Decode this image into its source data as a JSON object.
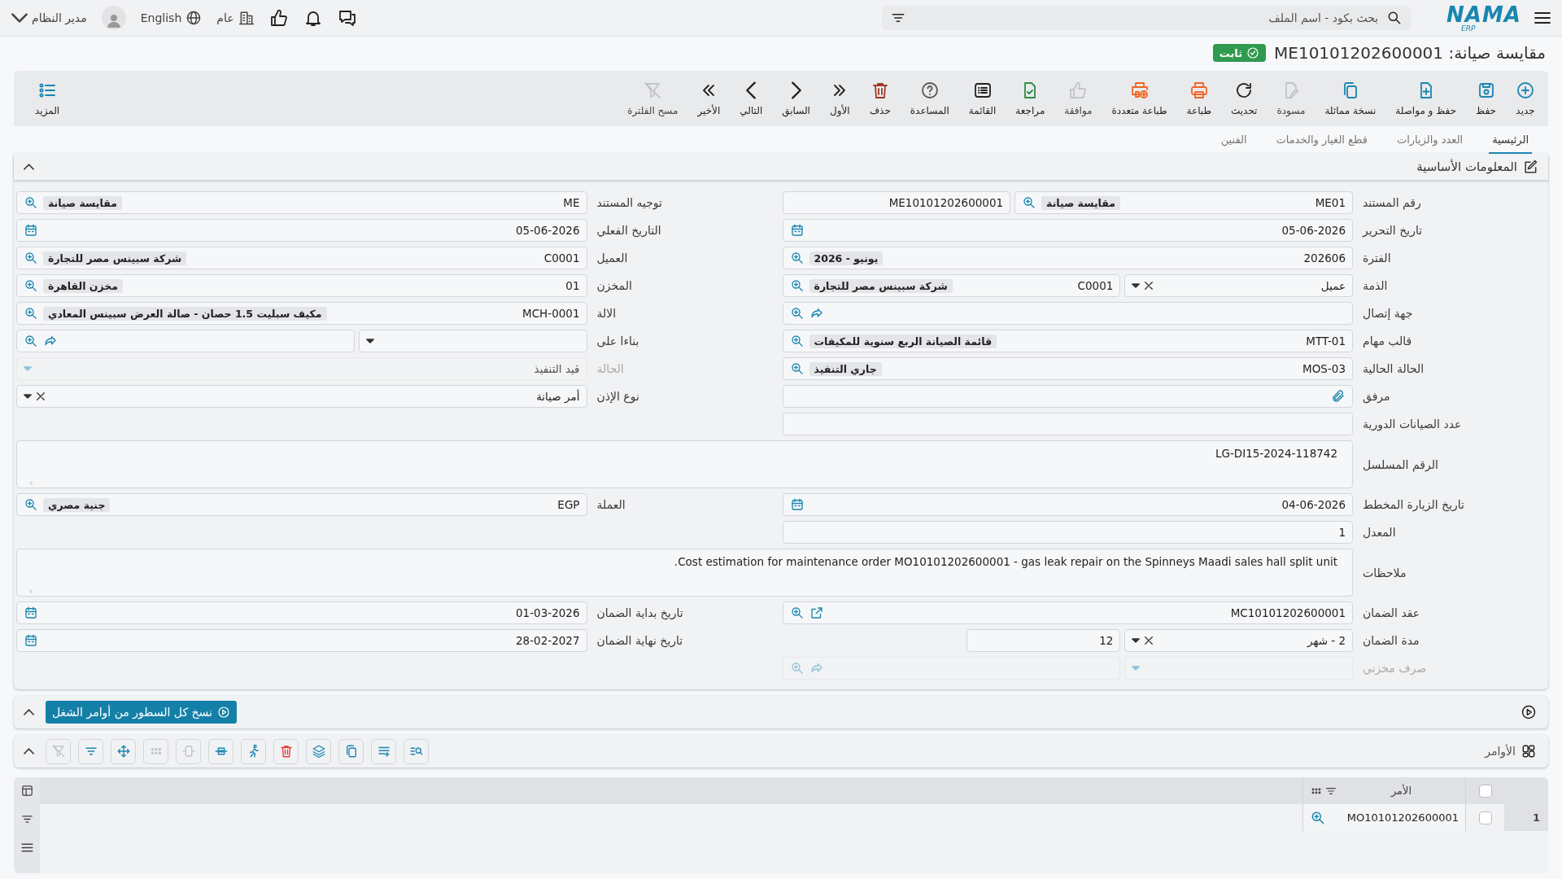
{
  "header": {
    "logo": "NAMA",
    "logo_sub": "ERP",
    "search": {
      "placeholder": "بحث بكود - اسم الملف"
    },
    "branch": "عام",
    "language": "English",
    "user": "مدير النظام"
  },
  "title": {
    "text": "مقايسة صيانة: ME10101202600001",
    "status": "ثابت"
  },
  "toolbar": [
    {
      "kind": "new",
      "label": "جديد",
      "disabled": false
    },
    {
      "kind": "save",
      "label": "حفظ",
      "disabled": false
    },
    {
      "kind": "save-continue",
      "label": "حفظ و مواصلة",
      "disabled": false
    },
    {
      "kind": "duplicate",
      "label": "نسخة مماثلة",
      "disabled": false
    },
    {
      "kind": "draft",
      "label": "مسودة",
      "disabled": true
    },
    {
      "kind": "refresh",
      "label": "تحديث",
      "disabled": false
    },
    {
      "kind": "print",
      "label": "طباعة",
      "disabled": false
    },
    {
      "kind": "print-multi",
      "label": "طباعة متعددة",
      "disabled": false
    },
    {
      "kind": "approve",
      "label": "موافقة",
      "disabled": true
    },
    {
      "kind": "review",
      "label": "مراجعة",
      "disabled": false
    },
    {
      "kind": "list",
      "label": "القائمة",
      "disabled": false
    },
    {
      "kind": "help",
      "label": "المساعدة",
      "disabled": false
    },
    {
      "kind": "delete",
      "label": "حذف",
      "disabled": false
    },
    {
      "kind": "first",
      "label": "الأول",
      "disabled": false
    },
    {
      "kind": "previous",
      "label": "السابق",
      "disabled": false
    },
    {
      "kind": "next",
      "label": "التالي",
      "disabled": false
    },
    {
      "kind": "last",
      "label": "الأخير",
      "disabled": false
    },
    {
      "kind": "clear-filter",
      "label": "مسح الفلترة",
      "disabled": true
    }
  ],
  "more": "المزيد",
  "tabs": [
    {
      "label": "الرئيسية",
      "selected": true
    },
    {
      "label": "العدد والزيارات",
      "selected": false
    },
    {
      "label": "قطع الغيار والخدمات",
      "selected": false
    },
    {
      "label": "الفنين",
      "selected": false
    }
  ],
  "section": {
    "title": "المعلومات الأساسية",
    "expanded": true,
    "rows": [
      {
        "kind": "pair",
        "cells": [
          {
            "label": "رقم المستند",
            "disabled": false,
            "parts": [
              {
                "kind": "lookup",
                "value": "ME01",
                "chip": "مقايسة صيانة"
              },
              {
                "kind": "text",
                "value": "ME10101202600001"
              }
            ]
          },
          {
            "label": "توجيه المستند",
            "disabled": false,
            "parts": [
              {
                "kind": "lookup",
                "value": "ME",
                "chip": "مقايسة صيانة"
              }
            ]
          }
        ]
      },
      {
        "kind": "pair",
        "cells": [
          {
            "label": "تاريخ التحرير",
            "disabled": false,
            "parts": [
              {
                "kind": "date",
                "value": "05-06-2026"
              }
            ]
          },
          {
            "label": "التاريخ الفعلي",
            "disabled": false,
            "parts": [
              {
                "kind": "date",
                "value": "05-06-2026"
              }
            ]
          }
        ]
      },
      {
        "kind": "pair",
        "cells": [
          {
            "label": "الفترة",
            "disabled": false,
            "parts": [
              {
                "kind": "lookup",
                "value": "202606",
                "chip": "يونيو - 2026"
              }
            ]
          },
          {
            "label": "العميل",
            "disabled": false,
            "parts": [
              {
                "kind": "lookup",
                "value": "C0001",
                "chip": "شركة سبينس مصر للتجارة"
              }
            ]
          }
        ]
      },
      {
        "kind": "pair",
        "cells": [
          {
            "label": "الذمة",
            "disabled": false,
            "parts": [
              {
                "kind": "select",
                "value": "عميل",
                "clearable": true
              },
              {
                "kind": "lookup",
                "value": "C0001",
                "chip": "شركة سبينس مصر للتجارة"
              }
            ]
          },
          {
            "label": "المخزن",
            "disabled": false,
            "parts": [
              {
                "kind": "lookup",
                "value": "01",
                "chip": "مخزن القاهرة"
              }
            ]
          }
        ]
      },
      {
        "kind": "pair",
        "cells": [
          {
            "label": "جهة إتصال",
            "disabled": false,
            "parts": [
              {
                "kind": "lookup-share"
              }
            ]
          },
          {
            "label": "الالة",
            "disabled": false,
            "parts": [
              {
                "kind": "lookup",
                "value": "MCH-0001",
                "chip": "مكيف سبليت 1.5 حصان - صالة العرض سبينس المعادي"
              }
            ]
          }
        ]
      },
      {
        "kind": "pair",
        "cells": [
          {
            "label": "قالب مهام",
            "disabled": false,
            "parts": [
              {
                "kind": "lookup",
                "value": "MTT-01",
                "chip": "قائمة الصيانة الربع سنوية للمكيفات"
              }
            ]
          },
          {
            "label": "بناءا على",
            "disabled": false,
            "parts": [
              {
                "kind": "select",
                "clearable": false
              },
              {
                "kind": "lookup-share"
              }
            ]
          }
        ]
      },
      {
        "kind": "pair",
        "cells": [
          {
            "label": "الحالة الحالية",
            "disabled": false,
            "parts": [
              {
                "kind": "lookup",
                "value": "MOS-03",
                "chip": "جاري التنفيذ"
              }
            ]
          },
          {
            "label": "الحالة",
            "disabled": true,
            "parts": [
              {
                "kind": "select",
                "value": "قيد التنفيذ",
                "clearable": false
              }
            ]
          }
        ]
      },
      {
        "kind": "pair",
        "cells": [
          {
            "label": "مرفق",
            "disabled": false,
            "parts": [
              {
                "kind": "attach"
              }
            ]
          },
          {
            "label": "نوع الإذن",
            "disabled": false,
            "parts": [
              {
                "kind": "select",
                "value": "أمر صيانة",
                "clearable": true
              }
            ]
          }
        ]
      },
      {
        "kind": "pair",
        "cells": [
          {
            "label": "عدد الصيانات الدورية",
            "disabled": false,
            "parts": [
              {
                "kind": "text"
              }
            ]
          }
        ]
      },
      {
        "kind": "wide",
        "cells": [
          {
            "label": "الرقم المسلسل",
            "disabled": false,
            "parts": [
              {
                "kind": "textarea",
                "value": "LG-DI15-2024-118742"
              }
            ]
          }
        ]
      },
      {
        "kind": "pair",
        "cells": [
          {
            "label": "تاريخ الزيارة المخطط",
            "disabled": false,
            "parts": [
              {
                "kind": "date",
                "value": "04-06-2026"
              }
            ]
          },
          {
            "label": "العملة",
            "disabled": false,
            "parts": [
              {
                "kind": "lookup",
                "value": "EGP",
                "chip": "جنية مصري"
              }
            ]
          }
        ]
      },
      {
        "kind": "pair",
        "cells": [
          {
            "label": "المعدل",
            "disabled": false,
            "parts": [
              {
                "kind": "text",
                "value": "1"
              }
            ]
          }
        ]
      },
      {
        "kind": "wide",
        "cells": [
          {
            "label": "ملاحظات",
            "disabled": false,
            "parts": [
              {
                "kind": "textarea",
                "value": "Cost estimation for maintenance order MO10101202600001 - gas leak repair on the Spinneys Maadi sales hall split unit."
              }
            ]
          }
        ]
      },
      {
        "kind": "pair",
        "cells": [
          {
            "label": "عقد الضمان",
            "disabled": false,
            "parts": [
              {
                "kind": "lookup-open",
                "value": "MC10101202600001"
              }
            ]
          },
          {
            "label": "تاريخ بداية الضمان",
            "disabled": false,
            "parts": [
              {
                "kind": "date",
                "value": "01-03-2026"
              }
            ]
          }
        ]
      },
      {
        "kind": "pair",
        "cells": [
          {
            "label": "مدة الضمان",
            "disabled": false,
            "parts": [
              {
                "kind": "select",
                "value": "2 - شهر",
                "clearable": true
              },
              {
                "kind": "number",
                "value": "12"
              }
            ]
          },
          {
            "label": "تاريخ نهاية الضمان",
            "disabled": false,
            "parts": [
              {
                "kind": "date",
                "value": "28-02-2027"
              }
            ]
          }
        ]
      },
      {
        "kind": "pair",
        "cells": [
          {
            "label": "صرف مخزني",
            "disabled": true,
            "parts": [
              {
                "kind": "select",
                "clearable": false
              },
              {
                "kind": "lookup-share"
              }
            ]
          }
        ]
      }
    ]
  },
  "orders": {
    "run_button": "نسخ كل السطور من أوامر الشغل",
    "title": "الأوامر",
    "expanded": true,
    "all_selected": false,
    "columns": [
      "الأمر"
    ],
    "rows": [
      {
        "number": "1",
        "selected": false,
        "order": "MO10101202600001"
      }
    ]
  }
}
